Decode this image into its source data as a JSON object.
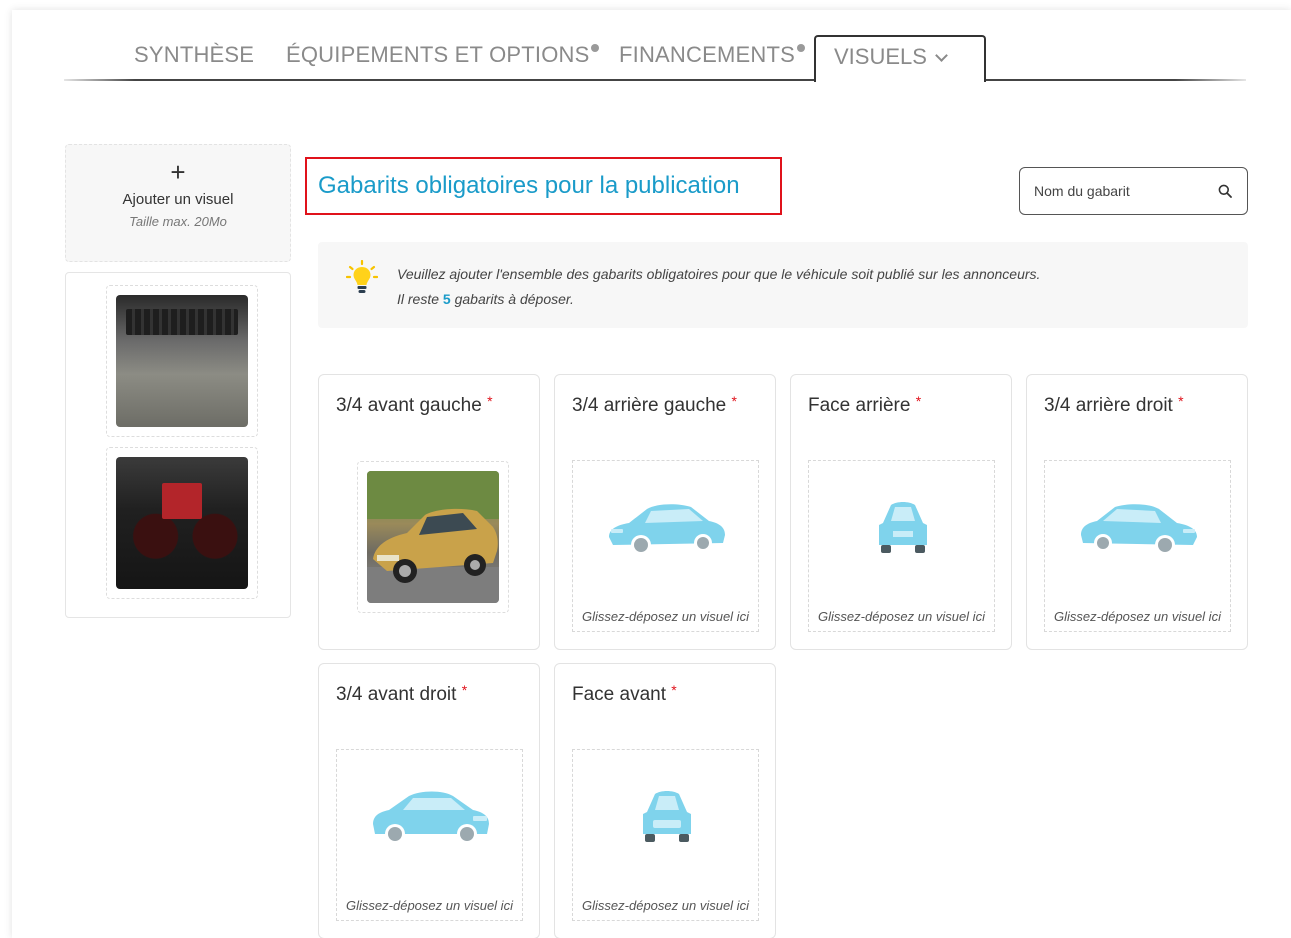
{
  "tabs": [
    {
      "label": "SYNTHÈSE",
      "badge": false
    },
    {
      "label": "ÉQUIPEMENTS ET OPTIONS",
      "badge": true
    },
    {
      "label": "FINANCEMENTS",
      "badge": true
    },
    {
      "label": "VISUELS",
      "active": true
    }
  ],
  "sidebar": {
    "add_icon": "+",
    "add_label": "Ajouter un visuel",
    "add_size": "Taille max. 20Mo",
    "thumbnails": [
      "trunk-photo",
      "dashboard-photo"
    ]
  },
  "main": {
    "title": "Gabarits obligatoires pour la publication",
    "search_placeholder": "Nom du gabarit",
    "info_line1": "Veuillez ajouter l'ensemble des gabarits obligatoires pour que le véhicule soit publié sur les annonceurs.",
    "info_prefix": "Il reste ",
    "info_count": "5",
    "info_suffix": " gabarits à déposer.",
    "required_mark": "*",
    "drop_text": "Glissez-déposez un visuel ici",
    "templates": [
      {
        "label": "3/4 avant gauche",
        "filled": true
      },
      {
        "label": "3/4 arrière gauche",
        "filled": false
      },
      {
        "label": "Face arrière",
        "filled": false
      },
      {
        "label": "3/4 arrière droit",
        "filled": false
      },
      {
        "label": "3/4 avant droit",
        "filled": false
      },
      {
        "label": "Face avant",
        "filled": false
      }
    ]
  },
  "colors": {
    "accent": "#1a9bc9",
    "required": "#e0121b",
    "car_placeholder": "#7fd3ec"
  }
}
